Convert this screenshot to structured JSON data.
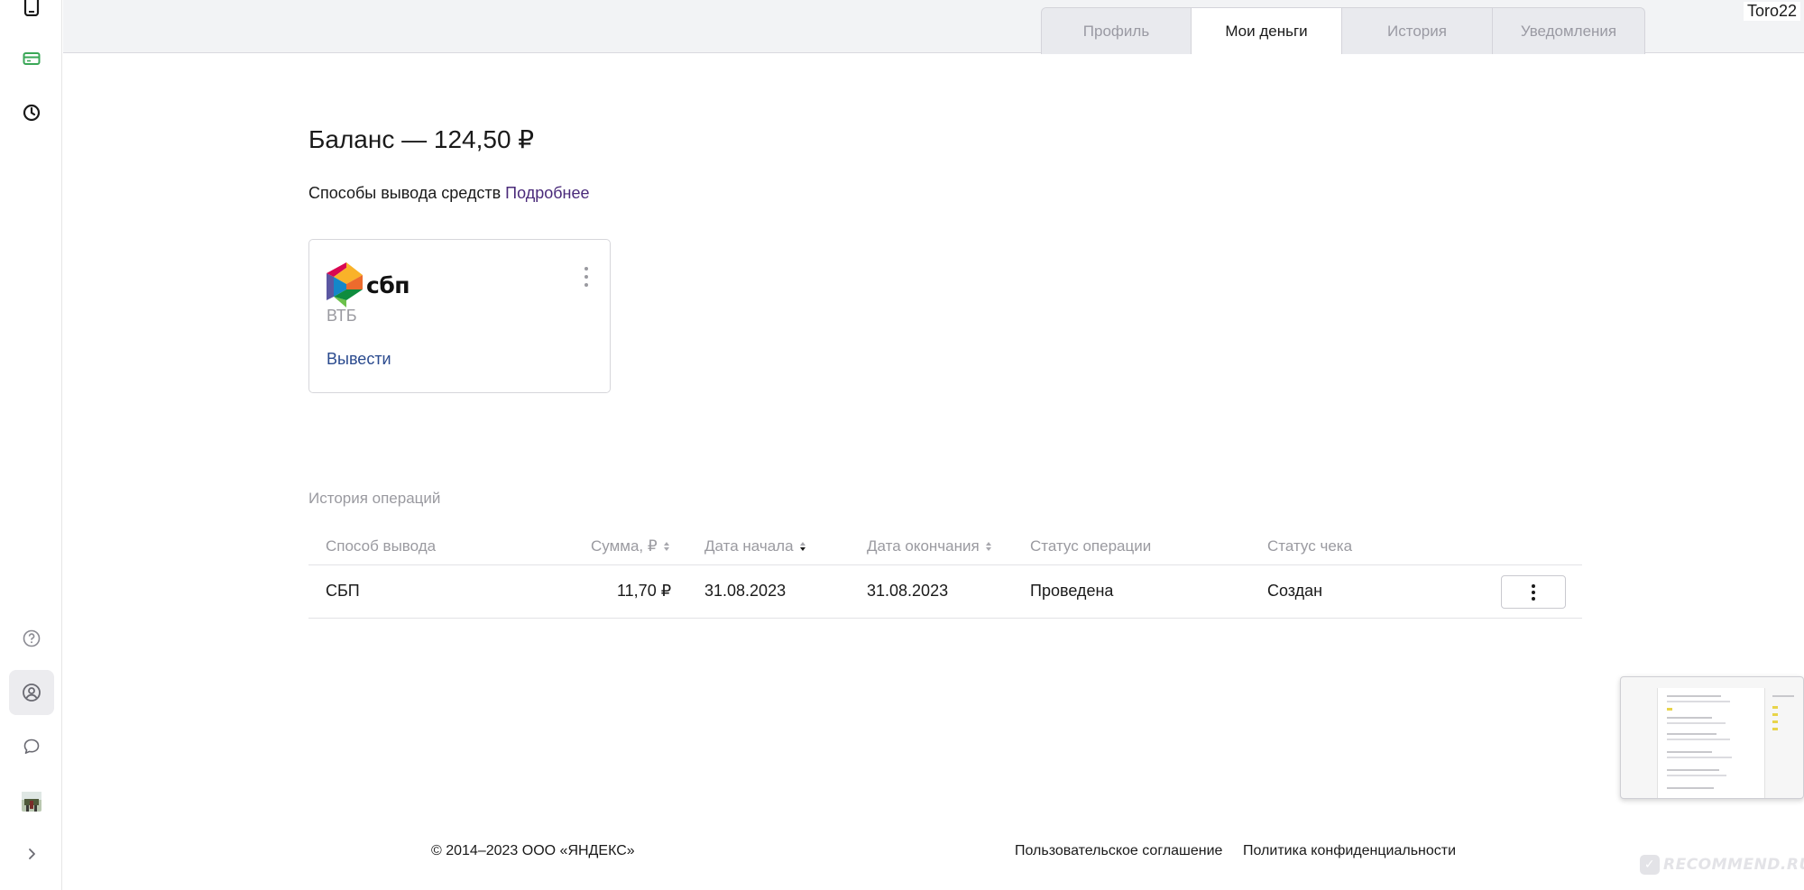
{
  "sidebar": {
    "icons": [
      "phone-icon",
      "card-icon",
      "clock-icon",
      "help-icon",
      "profile-icon",
      "chat-icon",
      "avatar",
      "chevron-right-icon"
    ]
  },
  "header": {
    "tabs": [
      {
        "label": "Профиль"
      },
      {
        "label": "Мои деньги"
      },
      {
        "label": "История"
      },
      {
        "label": "Уведомления"
      }
    ],
    "active_tab": "Мои деньги",
    "username": "Toro22"
  },
  "main": {
    "balance": "Баланс — 124,50 ₽",
    "withdraw_methods_label": "Способы вывода средств",
    "more_link": "Подробнее",
    "card": {
      "brand": "сбп",
      "bank": "ВТБ",
      "action": "Вывести"
    },
    "history_title": "История операций",
    "table": {
      "columns": [
        "Способ вывода",
        "Сумма, ₽",
        "Дата начала",
        "Дата окончания",
        "Статус операции",
        "Статус чека"
      ],
      "rows": [
        {
          "method": "СБП",
          "amount": "11,70 ₽",
          "start": "31.08.2023",
          "end": "31.08.2023",
          "op_status": "Проведена",
          "receipt_status": "Создан"
        }
      ]
    }
  },
  "footer": {
    "copyright": "© 2014–2023 ООО «ЯНДЕКС»",
    "terms": "Пользовательское соглашение",
    "privacy": "Политика конфиденциальности"
  },
  "watermark": "RECOMMEND.RU",
  "colors": {
    "link": "#4a2a7a",
    "action": "#2a4a8e",
    "accent_green": "#3aa757"
  }
}
